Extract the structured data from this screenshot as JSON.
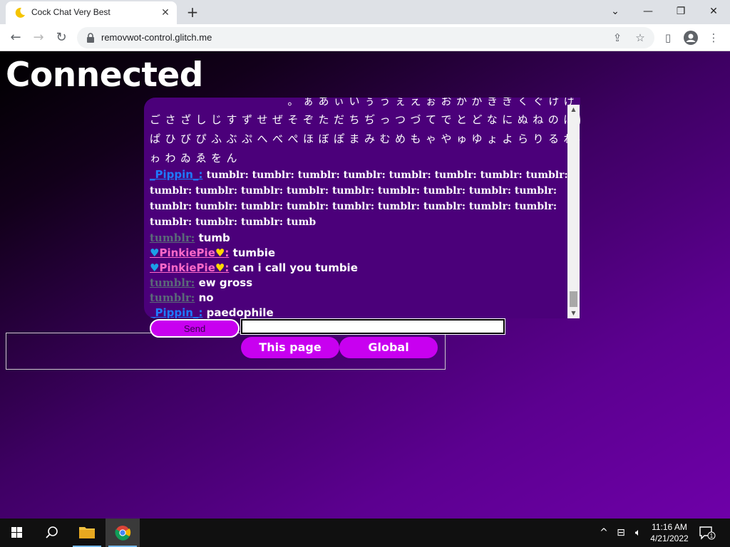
{
  "browser": {
    "tab_title": "Cock Chat Very Best",
    "url": "removwot-control.glitch.me",
    "new_tab": "+",
    "close_tab": "✕"
  },
  "page": {
    "status": "Connected",
    "japanese_lines": [
      "　　　　　　　　　。ぁあぃいぅうぇえぉおかがきぎくぐけげこ",
      "ごさざしじすずせぜそぞただちぢっつづてでとどなにぬねのはば",
      "ぱひびぴふぶぷへべぺほぼぽまみむめもゃやゅゆょよらりるれろ",
      "ゎわゐゑをん"
    ],
    "messages": [
      {
        "user": "_Pippin_",
        "sep": ":",
        "kind": "pippin",
        "text": "tumblr: tumblr: tumblr: tumblr: tumblr: tumblr: tumblr: tumblr: tumblr: tumblr: tumblr: tumblr: tumblr: tumblr: tumblr: tumblr: tumblr: tumblr: tumblr: tumblr: tumblr: tumblr: tumblr: tumblr: tumblr: tumblr: tumblr: tumblr: tumblr: tumb",
        "serif": true
      },
      {
        "user": "tumblr:",
        "sep": "",
        "kind": "tumblr",
        "text": "tumb"
      },
      {
        "user": "PinkiePie",
        "sep": ":",
        "kind": "pinkie",
        "text": "tumbie"
      },
      {
        "user": "PinkiePie",
        "sep": ":",
        "kind": "pinkie",
        "text": "can i call you tumbie"
      },
      {
        "user": "tumblr:",
        "sep": "",
        "kind": "tumblr",
        "text": "ew gross"
      },
      {
        "user": "tumblr:",
        "sep": "",
        "kind": "tumblr",
        "text": "no"
      },
      {
        "user": "_Pippin_",
        "sep": ":",
        "kind": "pippin",
        "text": "paedophile"
      }
    ],
    "send_label": "Send",
    "input_value": "",
    "tab_this_page": "This page",
    "tab_global": "Global"
  },
  "taskbar": {
    "time": "11:16 AM",
    "date": "4/21/2022",
    "notification_count": "1"
  },
  "colors": {
    "accent": "#c800f0",
    "chat_bg": "#4b007a",
    "pippin": "#1e7bff",
    "pinkie": "#ff69c8",
    "tumblr": "#5a6a78"
  }
}
